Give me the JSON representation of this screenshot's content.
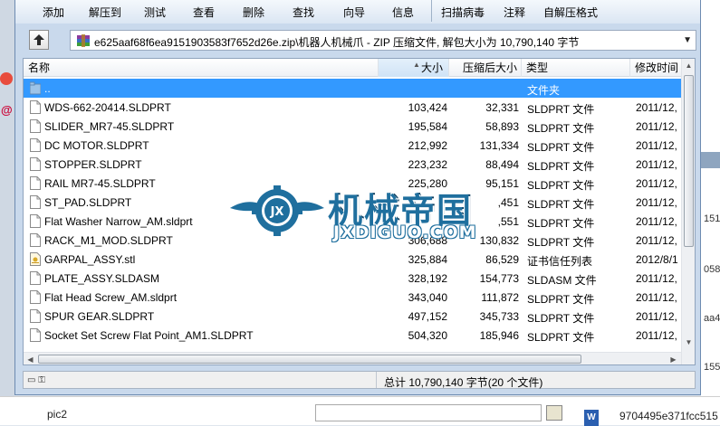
{
  "toolbar": {
    "buttons": [
      "添加",
      "解压到",
      "测试",
      "查看",
      "删除",
      "查找",
      "向导",
      "信息",
      "扫描病毒",
      "注释",
      "自解压格式"
    ]
  },
  "address": {
    "path": "e625aaf68f6ea9151903583f7652d26e.zip\\机器人机械爪 - ZIP 压缩文件, 解包大小为 10,790,140 字节"
  },
  "columns": {
    "name": "名称",
    "size": "大小",
    "packed": "压缩后大小",
    "type": "类型",
    "modified": "修改时间"
  },
  "files": [
    {
      "name": "..",
      "size": "",
      "packed": "",
      "type": "文件夹",
      "modified": "",
      "icon": "folder-icon",
      "selected": true
    },
    {
      "name": "WDS-662-20414.SLDPRT",
      "size": "103,424",
      "packed": "32,331",
      "type": "SLDPRT 文件",
      "modified": "2011/12,",
      "icon": "file-icon"
    },
    {
      "name": "SLIDER_MR7-45.SLDPRT",
      "size": "195,584",
      "packed": "58,893",
      "type": "SLDPRT 文件",
      "modified": "2011/12,",
      "icon": "file-icon"
    },
    {
      "name": "DC MOTOR.SLDPRT",
      "size": "212,992",
      "packed": "131,334",
      "type": "SLDPRT 文件",
      "modified": "2011/12,",
      "icon": "file-icon"
    },
    {
      "name": "STOPPER.SLDPRT",
      "size": "223,232",
      "packed": "88,494",
      "type": "SLDPRT 文件",
      "modified": "2011/12,",
      "icon": "file-icon"
    },
    {
      "name": "RAIL MR7-45.SLDPRT",
      "size": "225,280",
      "packed": "95,151",
      "type": "SLDPRT 文件",
      "modified": "2011/12,",
      "icon": "file-icon"
    },
    {
      "name": "ST_PAD.SLDPRT",
      "size": "",
      "packed": ",451",
      "type": "SLDPRT 文件",
      "modified": "2011/12,",
      "icon": "file-icon"
    },
    {
      "name": "Flat Washer Narrow_AM.sldprt",
      "size": "",
      "packed": ",551",
      "type": "SLDPRT 文件",
      "modified": "2011/12,",
      "icon": "file-icon"
    },
    {
      "name": "RACK_M1_MOD.SLDPRT",
      "size": "306,688",
      "packed": "130,832",
      "type": "SLDPRT 文件",
      "modified": "2011/12,",
      "icon": "file-icon"
    },
    {
      "name": "GARPAL_ASSY.stl",
      "size": "325,884",
      "packed": "86,529",
      "type": "证书信任列表",
      "modified": "2012/8/1",
      "icon": "cert-icon"
    },
    {
      "name": "PLATE_ASSY.SLDASM",
      "size": "328,192",
      "packed": "154,773",
      "type": "SLDASM 文件",
      "modified": "2011/12,",
      "icon": "file-icon"
    },
    {
      "name": "Flat Head Screw_AM.sldprt",
      "size": "343,040",
      "packed": "111,872",
      "type": "SLDPRT 文件",
      "modified": "2011/12,",
      "icon": "file-icon"
    },
    {
      "name": "SPUR GEAR.SLDPRT",
      "size": "497,152",
      "packed": "345,733",
      "type": "SLDPRT 文件",
      "modified": "2011/12,",
      "icon": "file-icon"
    },
    {
      "name": "Socket Set Screw Flat Point_AM1.SLDPRT",
      "size": "504,320",
      "packed": "185,946",
      "type": "SLDPRT 文件",
      "modified": "2011/12,",
      "icon": "file-icon"
    }
  ],
  "status": {
    "summary": "总计 10,790,140 字节(20 个文件)"
  },
  "watermark": {
    "title": "机械帝国",
    "url": "JXDIGUO.COM",
    "logo_text": "JX"
  },
  "background": {
    "bottom_label": "pic2",
    "bottom_file": "9704495e371fcc515",
    "right_texts": [
      "151",
      "058",
      "aa4",
      "155"
    ]
  }
}
